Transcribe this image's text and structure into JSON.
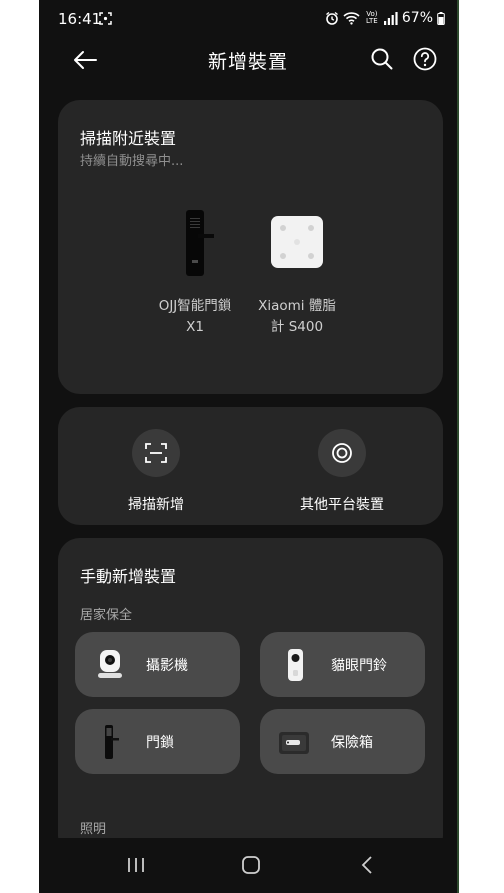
{
  "status_bar": {
    "time": "16:41",
    "network_label": "Vo) LTE",
    "battery_percent": "67%"
  },
  "header": {
    "title": "新增裝置",
    "back_icon": "arrow-left-icon",
    "search_icon": "search-icon",
    "help_icon": "help-circle-icon"
  },
  "scan_card": {
    "title": "掃描附近裝置",
    "subtitle": "持續自動搜尋中...",
    "devices": [
      {
        "label": "OJJ智能門鎖\nX1",
        "icon": "smart-lock-icon"
      },
      {
        "label": "Xiaomi 體脂\n計 S400",
        "icon": "body-scale-icon"
      }
    ]
  },
  "actions": {
    "scan_add": {
      "label": "掃描新增",
      "icon": "scan-icon"
    },
    "other_platform": {
      "label": "其他平台裝置",
      "icon": "target-icon"
    }
  },
  "manual_card": {
    "title": "手動新增裝置",
    "section_home_security": "居家保全",
    "tiles": [
      {
        "label": "攝影機",
        "icon": "camera-icon"
      },
      {
        "label": "貓眼門鈴",
        "icon": "doorbell-icon"
      },
      {
        "label": "門鎖",
        "icon": "door-lock-icon"
      },
      {
        "label": "保險箱",
        "icon": "safe-icon"
      }
    ],
    "section_lighting": "照明"
  },
  "colors": {
    "background": "#111111",
    "card": "#262626",
    "tile": "#4a4a4a",
    "text_primary": "#ffffff",
    "text_secondary": "#8f8f8f"
  }
}
